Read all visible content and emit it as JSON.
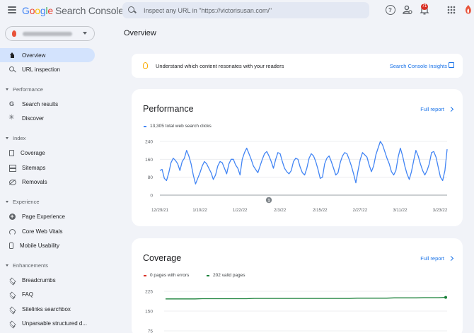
{
  "header": {
    "logo": {
      "G": "G",
      "o1": "o",
      "o2": "o",
      "g": "g",
      "l": "l",
      "e": "e",
      "product": "Search Console"
    },
    "search_placeholder": "Inspect any URL in \"https://victorisusan.com/\"",
    "notification_count": "71"
  },
  "sidebar": {
    "items": {
      "overview": "Overview",
      "url_inspection": "URL inspection",
      "search_results": "Search results",
      "discover": "Discover",
      "coverage": "Coverage",
      "sitemaps": "Sitemaps",
      "removals": "Removals",
      "page_experience": "Page Experience",
      "core_web_vitals": "Core Web Vitals",
      "mobile_usability": "Mobile Usability",
      "breadcrumbs": "Breadcrumbs",
      "faq": "FAQ",
      "sitelinks_searchbox": "Sitelinks searchbox",
      "unparsable": "Unparsable structured d..."
    },
    "sections": {
      "performance": "Performance",
      "index": "Index",
      "experience": "Experience",
      "enhancements": "Enhancements"
    }
  },
  "main": {
    "title": "Overview",
    "insights": {
      "text": "Understand which content resonates with your readers",
      "link": "Search Console Insights"
    },
    "performance_card": {
      "title": "Performance",
      "full_report": "Full report",
      "legend": "13,305 total web search clicks",
      "annotation": "1"
    },
    "coverage_card": {
      "title": "Coverage",
      "full_report": "Full report",
      "legend_errors": "0 pages with errors",
      "legend_valid": "202 valid pages"
    }
  },
  "colors": {
    "accent": "#1a73e8",
    "active_nav": "#d3e3fd",
    "clicks_line": "#4285f4",
    "valid_line": "#188038",
    "errors": "#d93025"
  },
  "chart_data": [
    {
      "type": "line",
      "series": [
        {
          "name": "13,305 total web search clicks",
          "values": [
            110,
            115,
            75,
            65,
            100,
            145,
            165,
            155,
            140,
            110,
            150,
            165,
            200,
            175,
            140,
            90,
            50,
            75,
            100,
            130,
            150,
            140,
            120,
            100,
            70,
            90,
            130,
            150,
            145,
            120,
            95,
            140,
            160,
            160,
            135,
            120,
            90,
            160,
            190,
            210,
            185,
            160,
            130,
            115,
            100,
            130,
            160,
            185,
            195,
            175,
            150,
            120,
            160,
            190,
            185,
            150,
            120,
            105,
            95,
            110,
            150,
            165,
            160,
            125,
            100,
            90,
            120,
            165,
            185,
            175,
            150,
            115,
            75,
            80,
            140,
            165,
            175,
            150,
            120,
            90,
            100,
            145,
            175,
            190,
            185,
            160,
            130,
            95,
            55,
            110,
            160,
            190,
            180,
            170,
            135,
            105,
            130,
            180,
            210,
            240,
            225,
            195,
            165,
            140,
            105,
            90,
            110,
            170,
            210,
            175,
            130,
            95,
            70,
            105,
            155,
            200,
            175,
            140,
            110,
            90,
            110,
            140,
            190,
            195,
            170,
            125,
            80,
            65,
            110,
            205
          ]
        }
      ],
      "ylim": [
        0,
        240
      ],
      "yticks": [
        0,
        80,
        160,
        240
      ],
      "x_tick_labels": [
        "12/29/21",
        "1/10/22",
        "1/22/22",
        "2/3/22",
        "2/15/22",
        "2/27/22",
        "3/11/22",
        "3/23/22"
      ]
    },
    {
      "type": "line",
      "series": [
        {
          "name": "202 valid pages",
          "values": [
            196,
            196,
            196,
            196,
            196,
            197,
            197,
            197,
            197,
            197,
            197,
            197,
            198,
            198,
            198,
            198,
            198,
            198,
            198,
            198,
            198,
            198,
            198,
            198,
            198,
            198,
            199,
            199,
            199,
            199,
            199,
            200,
            200,
            200,
            200,
            201,
            201,
            201,
            202
          ]
        },
        {
          "name": "0 pages with errors",
          "values": [
            0,
            0,
            0,
            0,
            0,
            0,
            0,
            0,
            0,
            0,
            0,
            0,
            0,
            0,
            0,
            0,
            0,
            0,
            0,
            0,
            0,
            0,
            0,
            0,
            0,
            0,
            0,
            0,
            0,
            0,
            0,
            0,
            0,
            0,
            0,
            0,
            0,
            0,
            0
          ]
        }
      ],
      "yticks": [
        75,
        150,
        225
      ]
    }
  ]
}
